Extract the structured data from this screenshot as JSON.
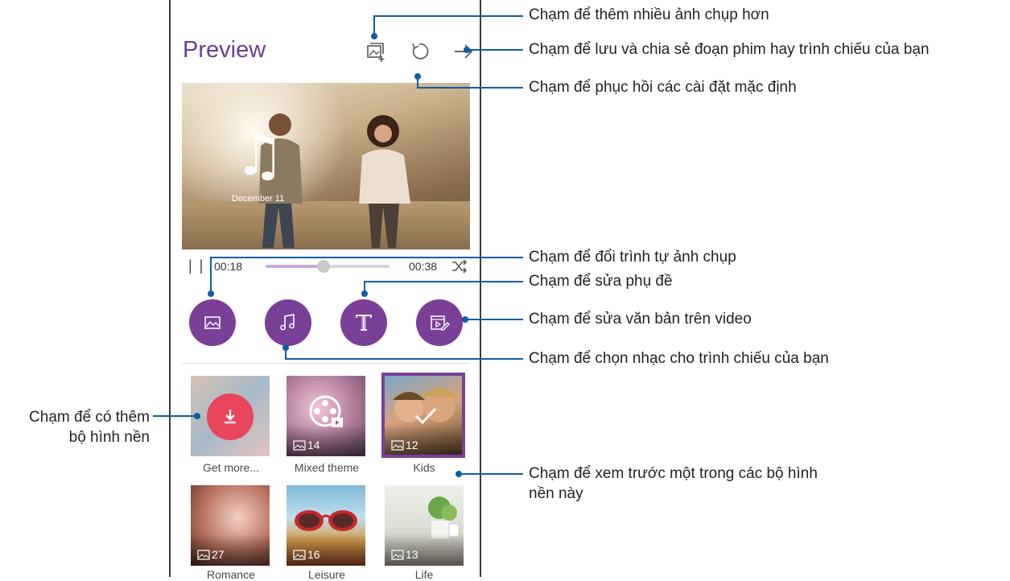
{
  "app": {
    "title": "Preview"
  },
  "toolbar": {
    "add_photos_icon": "add-photo-icon",
    "reset_icon": "reset-icon",
    "save_share_icon": "arrow-right-icon"
  },
  "preview": {
    "caption": "December 11"
  },
  "player": {
    "current_time": "00:18",
    "total_time": "00:38",
    "progress": 0.47,
    "pause_symbol": "| |",
    "shuffle_icon": "shuffle-icon"
  },
  "round_buttons": [
    {
      "name": "photos",
      "icon": "image-icon"
    },
    {
      "name": "music",
      "icon": "music-note-icon"
    },
    {
      "name": "subtitle",
      "icon": "text-t-icon"
    },
    {
      "name": "video-text",
      "icon": "video-edit-icon"
    }
  ],
  "themes": [
    {
      "label": "Get more...",
      "count": ""
    },
    {
      "label": "Mixed theme",
      "count": "14"
    },
    {
      "label": "Kids",
      "count": "12",
      "selected": true
    },
    {
      "label": "Romance",
      "count": "27"
    },
    {
      "label": "Leisure",
      "count": "16"
    },
    {
      "label": "Life",
      "count": "13"
    }
  ],
  "callouts": {
    "more_photos": "Chạm để thêm nhiều ảnh chụp hơn",
    "save_share": "Chạm để lưu và chia sẻ đoạn phim hay trình chiếu của bạn",
    "restore_defaults": "Chạm để phục hồi các cài đặt mặc định",
    "reorder": "Chạm để đổi trình tự ảnh chụp",
    "edit_subtitle": "Chạm để sửa phụ đề",
    "edit_video_text": "Chạm để sửa văn bản trên video",
    "choose_music": "Chạm để chọn nhạc cho trình chiếu của bạn",
    "more_backgrounds_line1": "Chạm để có thêm",
    "more_backgrounds_line2": "bộ hình nền",
    "preview_theme_line1": "Chạm để xem trước một trong các bộ hình",
    "preview_theme_line2": "nền này"
  },
  "colors": {
    "accent": "#7a3f97",
    "title": "#6b3c93",
    "callout_line": "#0b5ea8",
    "download": "#e8455d"
  }
}
